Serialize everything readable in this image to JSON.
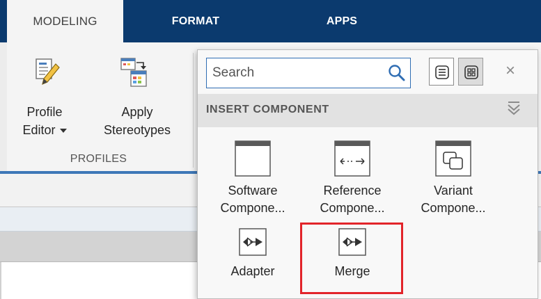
{
  "tabs": [
    {
      "label": "MODELING",
      "active": true
    },
    {
      "label": "FORMAT",
      "active": false
    },
    {
      "label": "APPS",
      "active": false
    }
  ],
  "ribbon": {
    "profile_editor": {
      "line1": "Profile",
      "line2": "Editor"
    },
    "apply_stereotypes": {
      "line1": "Apply",
      "line2": "Stereotypes"
    },
    "group_label": "PROFILES"
  },
  "gallery": {
    "search": {
      "placeholder": "Search",
      "value": ""
    },
    "close_glyph": "×",
    "section_title": "INSERT COMPONENT",
    "items": [
      {
        "line1": "Software",
        "line2": "Compone...",
        "icon": "software-component-icon"
      },
      {
        "line1": "Reference",
        "line2": "Compone...",
        "icon": "reference-component-icon"
      },
      {
        "line1": "Variant",
        "line2": "Compone...",
        "icon": "variant-component-icon"
      },
      {
        "line1": "Adapter",
        "icon": "adapter-icon"
      },
      {
        "line1": "Merge",
        "icon": "merge-icon",
        "highlighted": true
      }
    ]
  },
  "colors": {
    "tabstrip": "#0b3a6e",
    "accent": "#3d77b7",
    "highlight": "#e2242a"
  }
}
